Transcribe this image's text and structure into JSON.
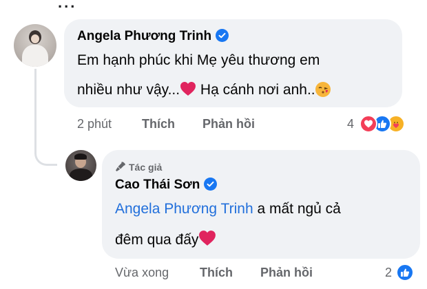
{
  "top": {
    "dots": "..."
  },
  "comment": {
    "author": "Angela Phương Trinh",
    "text_line1": "Em hạnh phúc khi Mẹ yêu thương em",
    "text_line2_part1": "nhiều như vậy...",
    "text_line2_part2": " Hạ cánh nơi anh..",
    "time": "2 phút",
    "like_label": "Thích",
    "reply_label": "Phản hồi",
    "reaction_count": "4",
    "reactions": [
      "love-icon",
      "like-icon",
      "care-icon"
    ]
  },
  "reply": {
    "badge": "Tác giả",
    "author": "Cao Thái Sơn",
    "mention": "Angela Phương Trinh",
    "text_line1_rest": " a mất ngủ cả",
    "text_line2": "đêm qua đấy",
    "time": "Vừa xong",
    "like_label": "Thích",
    "reply_label": "Phản hồi",
    "reaction_count": "2",
    "reactions": [
      "like-icon"
    ]
  },
  "colors": {
    "bubble": "#f0f2f5",
    "meta_text": "#65676b",
    "mention": "#216fdb",
    "verified": "#1877f2",
    "heart": "#e0245e"
  }
}
